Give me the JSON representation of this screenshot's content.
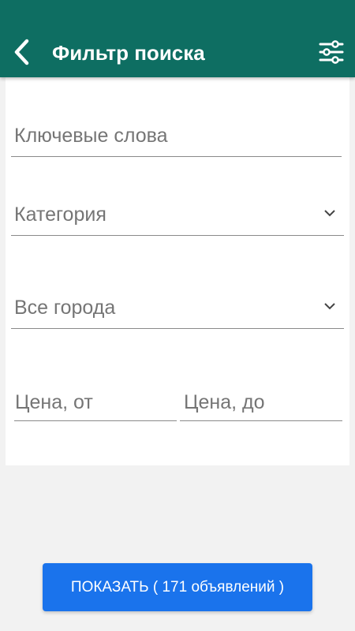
{
  "header": {
    "title": "Фильтр поиска",
    "back_icon": "arrow-back-icon",
    "filter_icon": "tune-sliders-icon",
    "background": "#0e6e62"
  },
  "form": {
    "keywords_placeholder": "Ключевые слова",
    "category_placeholder": "Категория",
    "city_placeholder": "Все города",
    "price_from_placeholder": "Цена, от",
    "price_to_placeholder": "Цена, до"
  },
  "show_button": {
    "label": "ПОКАЗАТЬ ( 171 объявлений )",
    "color": "#1a73ec"
  }
}
